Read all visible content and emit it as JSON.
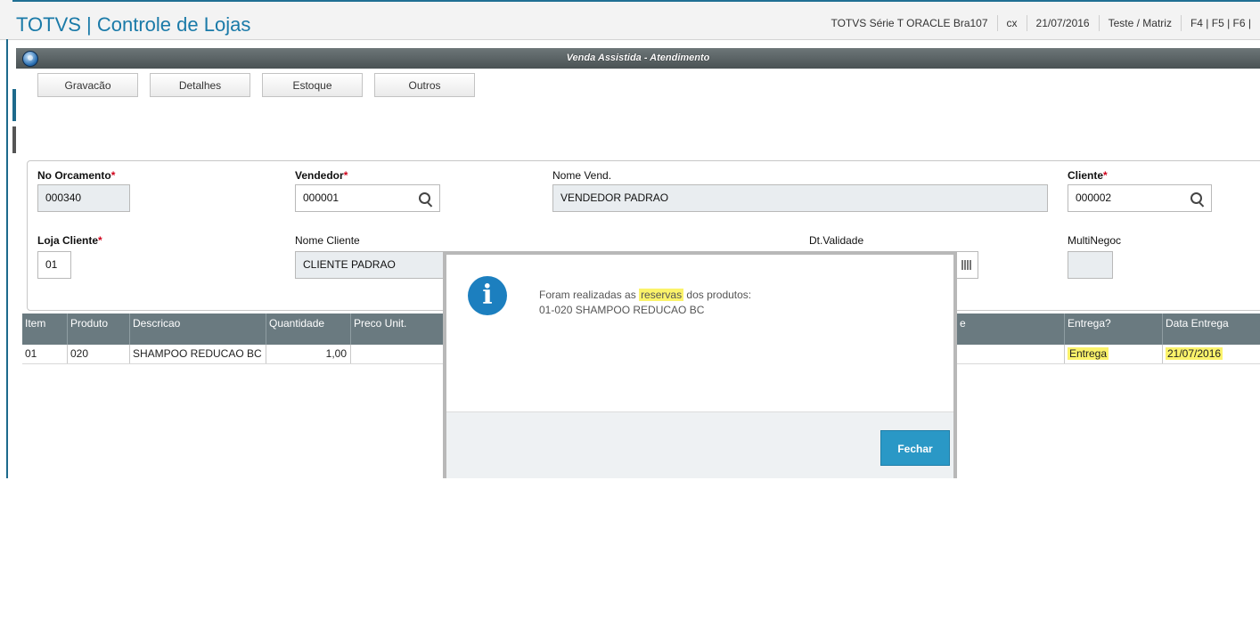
{
  "header": {
    "title": "TOTVS | Controle de Lojas",
    "info": [
      "TOTVS Série T  ORACLE Bra107",
      "cx",
      "21/07/2016",
      "Teste / Matriz",
      "F4 | F5 | F6 |"
    ]
  },
  "window": {
    "title": "Venda Assistida - Atendimento"
  },
  "toolbar": {
    "buttons": [
      "Gravacão",
      "Detalhes",
      "Estoque",
      "Outros"
    ]
  },
  "form": {
    "no_orcamento": {
      "label": "No Orcamento",
      "value": "000340"
    },
    "vendedor": {
      "label": "Vendedor",
      "value": "000001"
    },
    "nome_vend": {
      "label": "Nome Vend.",
      "value": "VENDEDOR PADRAO"
    },
    "cliente": {
      "label": "Cliente",
      "value": "000002"
    },
    "loja_cliente": {
      "label": "Loja Cliente",
      "value": "01"
    },
    "nome_cliente": {
      "label": "Nome Cliente",
      "value": "CLIENTE PADRAO"
    },
    "dt_validade": {
      "label": "Dt.Validade",
      "value": ""
    },
    "multinegoc": {
      "label": "MultiNegoc",
      "value": ""
    },
    "required_mark": "*"
  },
  "grid": {
    "columns": [
      "Item",
      "Produto",
      "Descricao",
      "Quantidade",
      "Preco Unit.",
      "e",
      "Entrega?",
      "Data Entrega"
    ],
    "rows": [
      {
        "item": "01",
        "produto": "020",
        "descricao": "SHAMPOO REDUCAO BC",
        "quantidade": "1,00",
        "preco": "",
        "entrega": "Entrega",
        "data_entrega": "21/07/2016"
      }
    ]
  },
  "dialog": {
    "message_prefix": "Foram realizadas as",
    "message_highlight": "reservas",
    "message_suffix": "dos produtos:",
    "message_line2": "01-020 SHAMPOO REDUCAO BC",
    "close_label": "Fechar"
  },
  "colors": {
    "brand": "#1a7aa8",
    "header_grid": "#6a7a80",
    "highlight": "#fbf36a",
    "primary_button": "#2a98c6",
    "required": "#d0021b"
  }
}
